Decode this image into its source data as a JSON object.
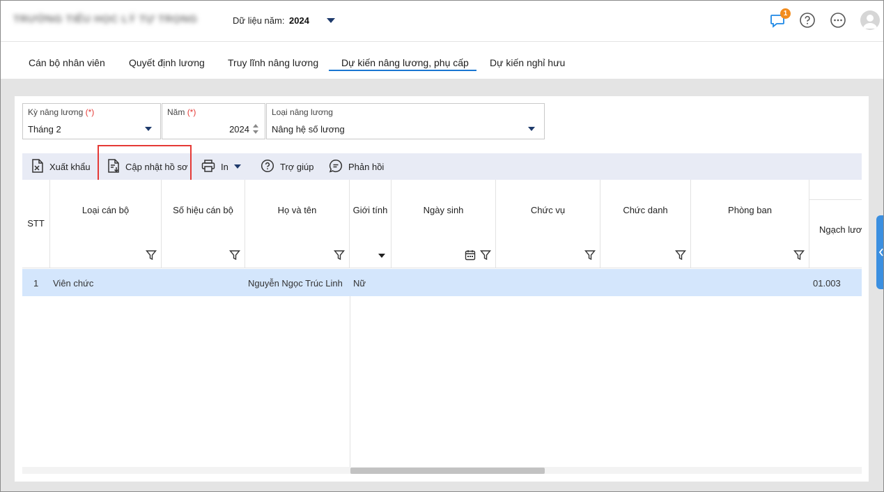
{
  "header": {
    "school_name": "TRƯỜNG TIỂU HỌC LÝ TỰ TRỌNG",
    "year_label": "Dữ liệu năm:",
    "year_value": "2024",
    "notification_count": "1"
  },
  "tabs": [
    {
      "label": "Cán bộ nhân viên"
    },
    {
      "label": "Quyết định lương"
    },
    {
      "label": "Truy lĩnh nâng lương"
    },
    {
      "label": "Dự kiến nâng lương, phụ cấp"
    },
    {
      "label": "Dự kiến nghỉ hưu"
    }
  ],
  "active_tab": "Dự kiến nâng lương, phụ cấp",
  "filters": {
    "period": {
      "label": "Kỳ nâng lương",
      "required": "(*)",
      "value": "Tháng 2"
    },
    "year": {
      "label": "Năm",
      "required": "(*)",
      "value": "2024"
    },
    "type": {
      "label": "Loại nâng lương",
      "value": "Nâng hệ số lương"
    }
  },
  "toolbar": {
    "export": "Xuất khẩu",
    "update_profile": "Cập nhật hồ sơ",
    "print": "In",
    "help": "Trợ giúp",
    "feedback": "Phản hồi"
  },
  "columns": [
    "STT",
    "Loại cán bộ",
    "Số hiệu cán bộ",
    "Họ và tên",
    "Giới tính",
    "Ngày sinh",
    "Chức vụ",
    "Chức danh",
    "Phòng ban",
    "Ngạch lươ"
  ],
  "rows": [
    {
      "stt": "1",
      "loai_can_bo": "Viên chức",
      "so_hieu": "",
      "ho_ten": "Nguyễn Ngọc Trúc Linh",
      "gioi_tinh": "Nữ",
      "ngay_sinh": "",
      "chuc_vu": "",
      "chuc_danh": "",
      "phong_ban": "",
      "ngach_luong": "01.003"
    }
  ],
  "colors": {
    "accent": "#1976d2",
    "toolbar_bg": "#e8ebf5",
    "row_selected": "#d4e6fc",
    "highlight": "#e53935",
    "badge": "#f28c1e"
  }
}
